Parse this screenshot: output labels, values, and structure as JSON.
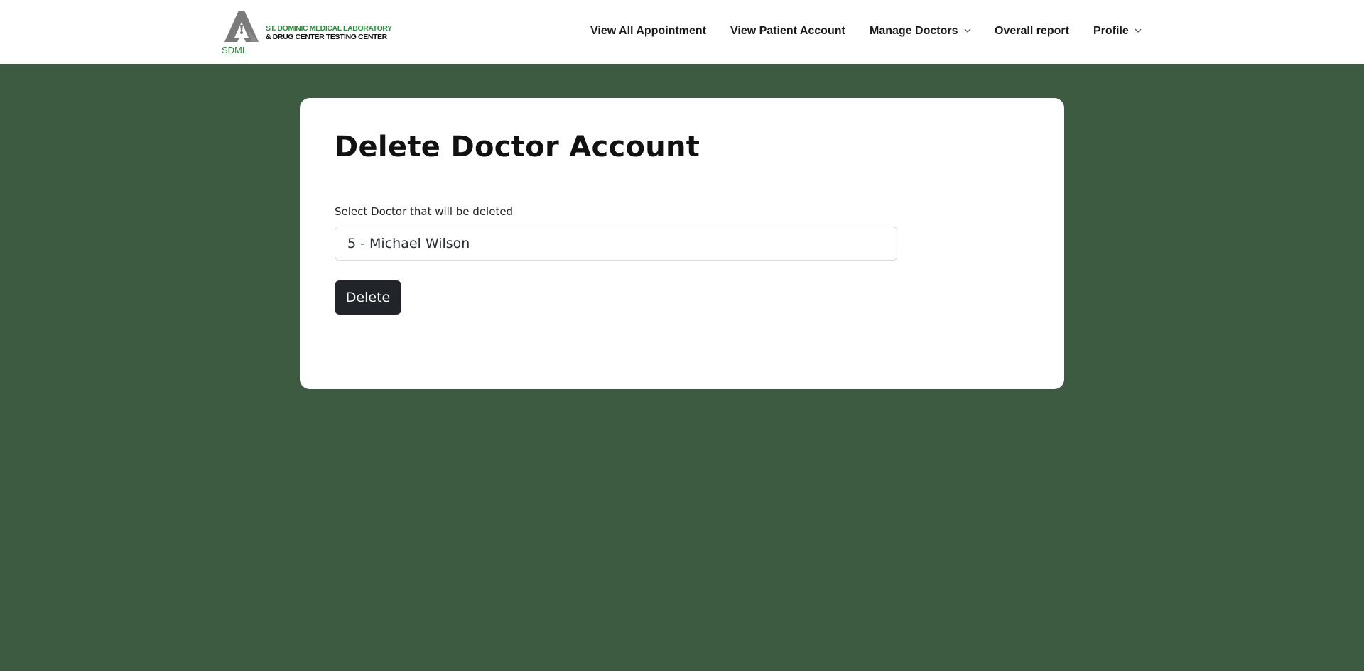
{
  "brand": {
    "name_line1": "ST. DOMINIC MEDICAL LABORATORY",
    "name_line2": "& DRUG CENTER TESTING CENTER",
    "abbr": "SDML",
    "green": "#2d8a3e",
    "gray": "#7a7a7a"
  },
  "nav": {
    "items": [
      {
        "label": "View All Appointment",
        "dropdown": false
      },
      {
        "label": "View Patient Account",
        "dropdown": false
      },
      {
        "label": "Manage Doctors",
        "dropdown": true
      },
      {
        "label": "Overall report",
        "dropdown": false
      },
      {
        "label": "Profile",
        "dropdown": true
      }
    ]
  },
  "page": {
    "background": "#3c5b41",
    "title": "Delete Doctor Account",
    "form": {
      "label": "Select Doctor that will be deleted",
      "selected_value": "5 - Michael Wilson",
      "submit_label": "Delete"
    }
  }
}
